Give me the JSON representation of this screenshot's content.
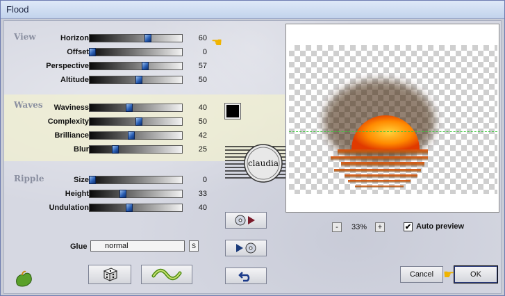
{
  "window": {
    "title": "Flood"
  },
  "sections": {
    "view": {
      "label": "View",
      "rows": [
        {
          "label": "Horizon",
          "value": 60
        },
        {
          "label": "Offset",
          "value": 0
        },
        {
          "label": "Perspective",
          "value": 57
        },
        {
          "label": "Altitude",
          "value": 50
        }
      ]
    },
    "waves": {
      "label": "Waves",
      "rows": [
        {
          "label": "Waviness",
          "value": 40
        },
        {
          "label": "Complexity",
          "value": 50
        },
        {
          "label": "Brilliance",
          "value": 42
        },
        {
          "label": "Blur",
          "value": 25
        }
      ]
    },
    "ripple": {
      "label": "Ripple",
      "rows": [
        {
          "label": "Size",
          "value": 0
        },
        {
          "label": "Height",
          "value": 33
        },
        {
          "label": "Undulation",
          "value": 40
        }
      ]
    }
  },
  "swatch_color": "#000000",
  "watermark_text": "claudia",
  "glue": {
    "label": "Glue",
    "value": "normal",
    "button": "S"
  },
  "zoom": {
    "minus": "-",
    "value": "33%",
    "plus": "+"
  },
  "auto_preview": {
    "label": "Auto preview",
    "checked": true
  },
  "buttons": {
    "cancel": "Cancel",
    "ok": "OK"
  },
  "icons": {
    "save_preset": "disc-arrow-icon",
    "load_preset": "arrow-disc-icon",
    "randomize": "dice-icon",
    "reset": "wave-icon",
    "undo": "undo-arrow-icon",
    "logo": "flaming-pear-icon",
    "pointer": "pointing-hand-icon"
  }
}
